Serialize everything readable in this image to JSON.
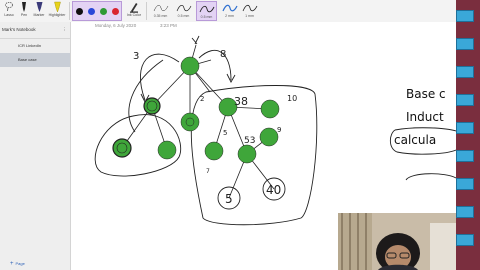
{
  "ribbon": {
    "tools": [
      {
        "label": "Lasso"
      },
      {
        "label": "Pen"
      },
      {
        "label": "Marker"
      },
      {
        "label": "Highlighter"
      }
    ],
    "colors": [
      "#111111",
      "#2a48d8",
      "#2e9a35",
      "#d9252f"
    ],
    "color_label": "Ink Color",
    "pen_presets": [
      {
        "label": "0.35 mm",
        "selected": false
      },
      {
        "label": "0.5 mm",
        "selected": false
      },
      {
        "label": "0.5 mm",
        "selected": true
      },
      {
        "label": "2 mm",
        "selected": false
      },
      {
        "label": "1 mm",
        "selected": false
      }
    ]
  },
  "sidebar": {
    "notebook_title": "Mark's Notebook",
    "pages": [
      {
        "label": "ICR LinkedIn",
        "active": false
      },
      {
        "label": "Base case",
        "active": true
      }
    ],
    "add_page_label": "Page"
  },
  "page": {
    "date": "Monday, 6 July 2020",
    "time": "3:23 PM",
    "notes": {
      "line1": "Base c",
      "line2": "Induct",
      "line3": "calcula"
    },
    "handwritten": [
      "3",
      "8",
      "2",
      "38",
      "10",
      "5",
      "9",
      "53",
      "7",
      "5",
      "40"
    ]
  }
}
